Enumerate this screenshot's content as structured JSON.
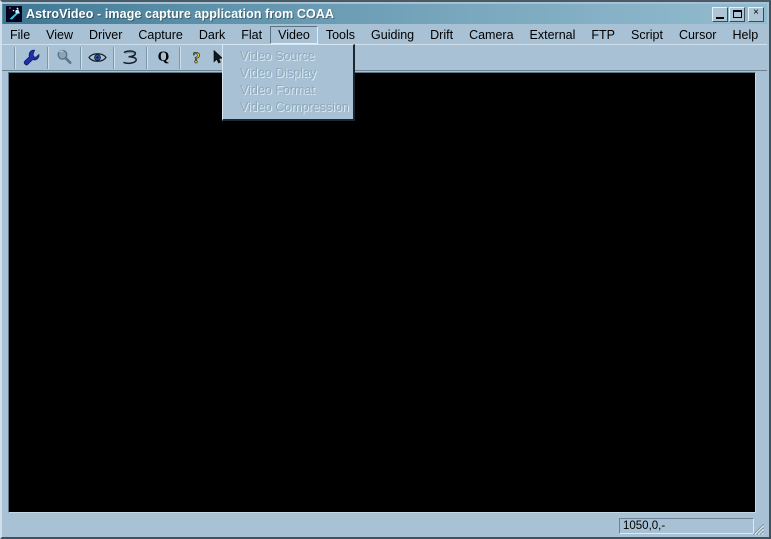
{
  "window": {
    "title": "AstroVideo - image capture application from COAA",
    "icon": "comet-icon",
    "controls": {
      "minimize_label": "_",
      "maximize_label": "□",
      "close_label": "×"
    }
  },
  "menubar": {
    "items": [
      {
        "label": "File",
        "open": false
      },
      {
        "label": "View",
        "open": false
      },
      {
        "label": "Driver",
        "open": false
      },
      {
        "label": "Capture",
        "open": false
      },
      {
        "label": "Dark",
        "open": false
      },
      {
        "label": "Flat",
        "open": false
      },
      {
        "label": "Video",
        "open": true
      },
      {
        "label": "Tools",
        "open": false
      },
      {
        "label": "Guiding",
        "open": false
      },
      {
        "label": "Drift",
        "open": false
      },
      {
        "label": "Camera",
        "open": false
      },
      {
        "label": "External",
        "open": false
      },
      {
        "label": "FTP",
        "open": false
      },
      {
        "label": "Script",
        "open": false
      },
      {
        "label": "Cursor",
        "open": false
      },
      {
        "label": "Help",
        "open": false
      }
    ]
  },
  "dropdown": {
    "owner": "Video",
    "items": [
      {
        "label": "Video Source",
        "enabled": false
      },
      {
        "label": "Video Display",
        "enabled": false
      },
      {
        "label": "Video Format",
        "enabled": false
      },
      {
        "label": "Video Compression",
        "enabled": false
      }
    ]
  },
  "toolbar": {
    "buttons": [
      {
        "icon": "wrench-icon",
        "enabled": true
      },
      {
        "icon": "magnifier-icon",
        "enabled": false
      },
      {
        "icon": "eye-icon",
        "enabled": true
      },
      {
        "icon": "curve-tool-icon",
        "enabled": true
      },
      {
        "icon": "quality-q-icon",
        "label": "Q",
        "enabled": true
      },
      {
        "icon": "help-question-icon",
        "enabled": true
      },
      {
        "icon": "context-help-icon",
        "enabled": true
      }
    ]
  },
  "canvas": {
    "name": "video-preview",
    "background": "#000000"
  },
  "statusbar": {
    "coordinates": "1050,0,-"
  },
  "colors": {
    "face": "#a9c1d4",
    "title_gradient_start": "#3e7692",
    "title_gradient_end": "#93bbcf",
    "accent_blue": "#1f2fa8",
    "disabled_text": "#8fa9bc"
  }
}
